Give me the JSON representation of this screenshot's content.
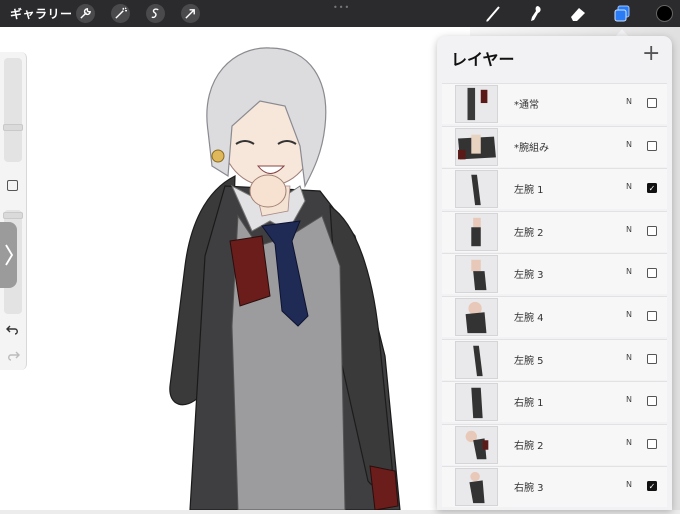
{
  "topbar": {
    "gallery_label": "ギャラリー",
    "left_tools": [
      {
        "name": "actions-wrench-icon"
      },
      {
        "name": "adjustments-wand-icon"
      },
      {
        "name": "selection-icon"
      },
      {
        "name": "transform-arrow-icon"
      }
    ],
    "right_tools": [
      {
        "name": "brush-icon"
      },
      {
        "name": "smudge-icon"
      },
      {
        "name": "eraser-icon"
      },
      {
        "name": "layers-icon",
        "active": true
      }
    ],
    "current_color": "#000000",
    "accent_color": "#2a7cf6"
  },
  "sidebar": {
    "undo_icon": "undo-icon",
    "redo_icon": "redo-icon"
  },
  "layers_panel": {
    "title": "レイヤー",
    "add_symbol": "+",
    "layers": [
      {
        "name": "*通常",
        "blend": "N",
        "visible": false
      },
      {
        "name": "*腕組み",
        "blend": "N",
        "visible": false
      },
      {
        "name": "左腕 1",
        "blend": "N",
        "visible": true
      },
      {
        "name": "左腕 2",
        "blend": "N",
        "visible": false
      },
      {
        "name": "左腕 3",
        "blend": "N",
        "visible": false
      },
      {
        "name": "左腕 4",
        "blend": "N",
        "visible": false
      },
      {
        "name": "左腕 5",
        "blend": "N",
        "visible": false
      },
      {
        "name": "右腕 1",
        "blend": "N",
        "visible": false
      },
      {
        "name": "右腕 2",
        "blend": "N",
        "visible": false
      },
      {
        "name": "右腕 3",
        "blend": "N",
        "visible": true
      }
    ]
  }
}
